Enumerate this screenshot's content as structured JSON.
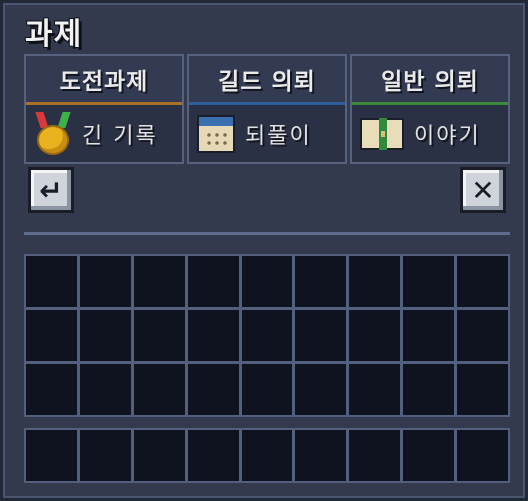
{
  "window": {
    "title": "과제"
  },
  "tabs": [
    {
      "label": "도전과제",
      "value": "긴 기록",
      "icon": "medal-icon",
      "underline": "#a9702a"
    },
    {
      "label": "길드 의뢰",
      "value": "되풀이",
      "icon": "calendar-icon",
      "underline": "#2e5d9c"
    },
    {
      "label": "일반 의뢰",
      "value": "이야기",
      "icon": "book-icon",
      "underline": "#3c8a3c"
    }
  ],
  "buttons": {
    "back": "↵",
    "close": "✕"
  },
  "inventory": {
    "main_rows": 3,
    "bottom_rows": 1,
    "columns": 9
  }
}
